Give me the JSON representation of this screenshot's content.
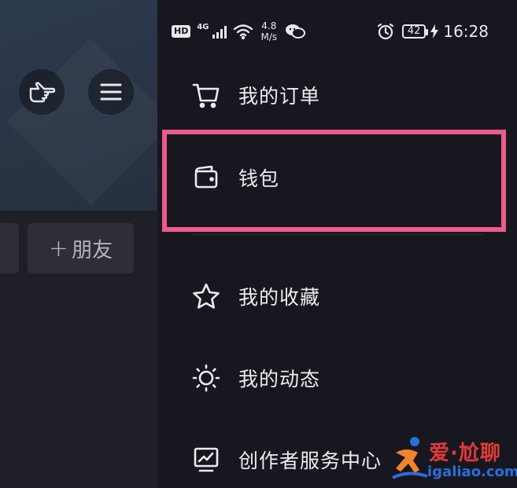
{
  "status_bar": {
    "hd": "HD",
    "network": "4G",
    "speed_value": "4.8",
    "speed_unit": "M/s",
    "battery": "42",
    "time": "16:28"
  },
  "background_app": {
    "friend_button_label": "朋友",
    "friend_button_prefix": "+"
  },
  "drawer": {
    "items": [
      {
        "label": "我的订单",
        "icon": "cart-icon"
      },
      {
        "label": "钱包",
        "icon": "wallet-icon"
      },
      {
        "label": "我的收藏",
        "icon": "star-icon"
      },
      {
        "label": "我的动态",
        "icon": "sun-icon"
      },
      {
        "label": "创作者服务中心",
        "icon": "chart-monitor-icon"
      }
    ]
  },
  "watermark": {
    "text": "爱·尬聊",
    "url": "igaliao.com"
  },
  "colors": {
    "highlight": "#ee5a8b",
    "drawer_bg": "#17181f"
  }
}
